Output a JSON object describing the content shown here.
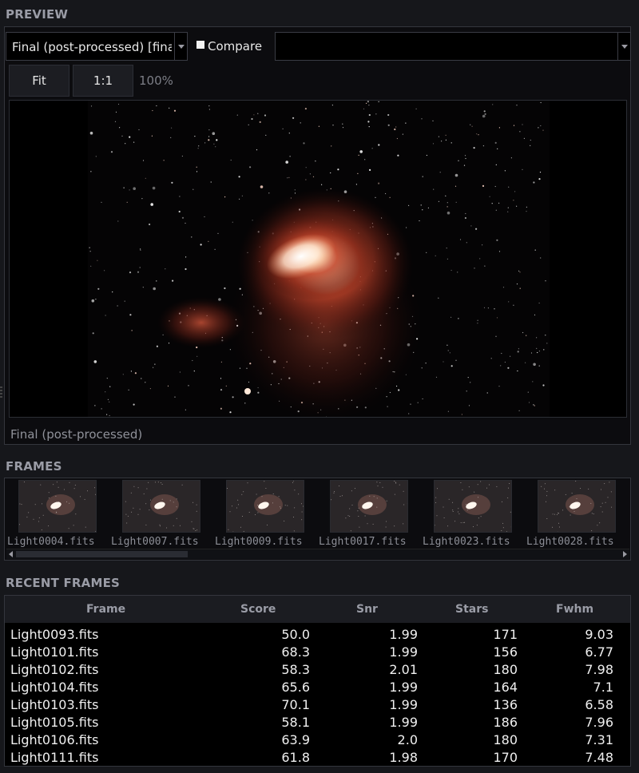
{
  "preview": {
    "section_title": "PREVIEW",
    "view_select": "Final (post-processed) [final]",
    "compare_label": "Compare",
    "compare_checked": false,
    "compare_select": "",
    "fit_label": "Fit",
    "one_to_one_label": "1:1",
    "zoom": "100%",
    "caption": "Final (post-processed)"
  },
  "frames": {
    "section_title": "FRAMES",
    "items": [
      {
        "label": "Light0004.fits"
      },
      {
        "label": "Light0007.fits"
      },
      {
        "label": "Light0009.fits"
      },
      {
        "label": "Light0017.fits"
      },
      {
        "label": "Light0023.fits"
      },
      {
        "label": "Light0028.fits"
      }
    ]
  },
  "recent": {
    "section_title": "RECENT FRAMES",
    "columns": [
      "Frame",
      "Score",
      "Snr",
      "Stars",
      "Fwhm"
    ],
    "rows": [
      {
        "frame": "Light0093.fits",
        "score": "50.0",
        "snr": "1.99",
        "stars": "171",
        "fwhm": "9.03"
      },
      {
        "frame": "Light0101.fits",
        "score": "68.3",
        "snr": "1.99",
        "stars": "156",
        "fwhm": "6.77"
      },
      {
        "frame": "Light0102.fits",
        "score": "58.3",
        "snr": "2.01",
        "stars": "180",
        "fwhm": "7.98"
      },
      {
        "frame": "Light0104.fits",
        "score": "65.6",
        "snr": "1.99",
        "stars": "164",
        "fwhm": "7.1"
      },
      {
        "frame": "Light0103.fits",
        "score": "70.1",
        "snr": "1.99",
        "stars": "136",
        "fwhm": "6.58"
      },
      {
        "frame": "Light0105.fits",
        "score": "58.1",
        "snr": "1.99",
        "stars": "186",
        "fwhm": "7.96"
      },
      {
        "frame": "Light0106.fits",
        "score": "63.9",
        "snr": "2.0",
        "stars": "180",
        "fwhm": "7.31"
      },
      {
        "frame": "Light0111.fits",
        "score": "61.8",
        "snr": "1.98",
        "stars": "170",
        "fwhm": "7.48"
      }
    ]
  },
  "colors": {
    "background": "#16171b",
    "panel": "#0c0c0f",
    "nebula_core": "#fff2e6",
    "nebula_glow": "#c0442a"
  }
}
